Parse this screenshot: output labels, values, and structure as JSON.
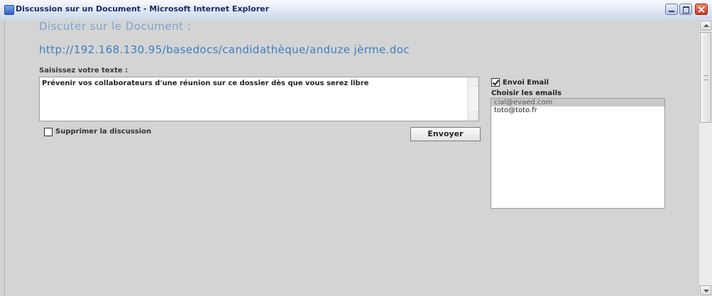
{
  "window": {
    "title": "Discussion sur un Document - Microsoft Internet Explorer",
    "icon": "ie-page-icon",
    "controls": [
      "minimize-icon",
      "maximize-icon",
      "close-icon"
    ]
  },
  "page": {
    "heading": "Discuter sur le Document :",
    "document_url": "http://192.168.130.95/basedocs/candidathèque/anduze jèrme.doc",
    "text_label": "Saisissez votre texte :",
    "message_text": "Prévenir  vos collaborateurs  d'une réunion sur ce dossier dès que vous serez libre",
    "delete_label": "Supprimer la discussion",
    "delete_checked": false,
    "send_label": "Envoyer",
    "email_label": "Envoi Email",
    "email_checked": true,
    "choose_label": "Choisir les emails",
    "emails": [
      {
        "address": "cial@evaed.com",
        "selected": true
      },
      {
        "address": "toto@toto.fr",
        "selected": false
      }
    ]
  },
  "colors": {
    "heading": "#7ba3cb",
    "url": "#3f7ec0",
    "background": "#d4d4d4"
  }
}
